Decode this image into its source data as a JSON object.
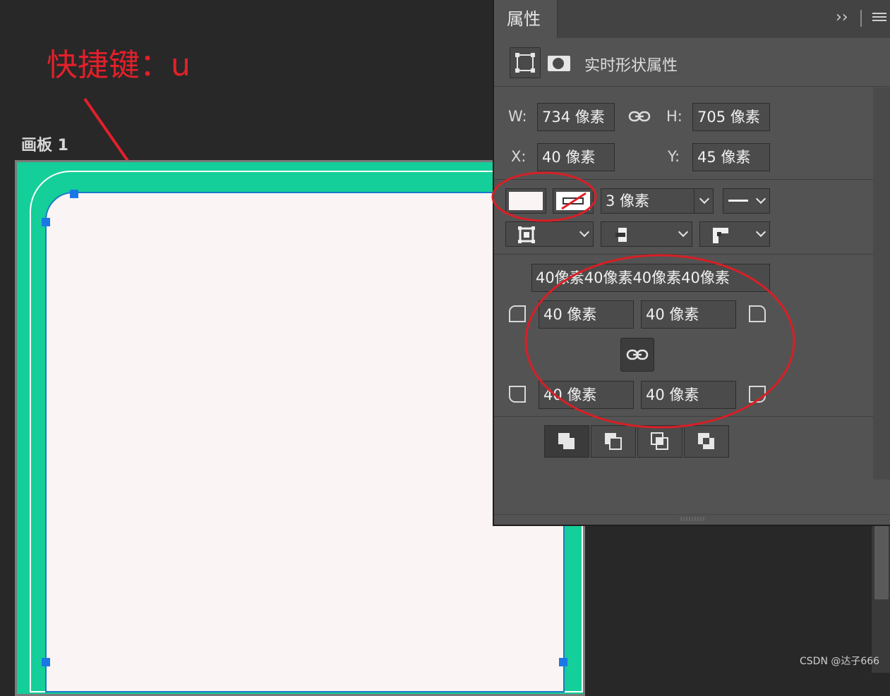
{
  "annotation": {
    "text": "快捷键：u"
  },
  "canvas": {
    "artboard_label": "画板 1"
  },
  "panel": {
    "tab_title": "属性",
    "subtitle": "实时形状属性",
    "w_label": "W:",
    "w_value": "734 像素",
    "h_label": "H:",
    "h_value": "705 像素",
    "x_label": "X:",
    "x_value": "40 像素",
    "y_label": "Y:",
    "y_value": "45 像素",
    "stroke_width": "3 像素",
    "corner_summary": "40像素40像素40像素40像素",
    "corner_tl": "40 像素",
    "corner_tr": "40 像素",
    "corner_bl": "40 像素",
    "corner_br": "40 像素"
  },
  "watermark": "CSDN @达子666",
  "colors": {
    "accent_red": "#e3202a",
    "artboard_green": "#14cf99",
    "shape_fill": "#faf5f4",
    "selection_blue": "#1a78e6",
    "panel_bg": "#535353"
  }
}
